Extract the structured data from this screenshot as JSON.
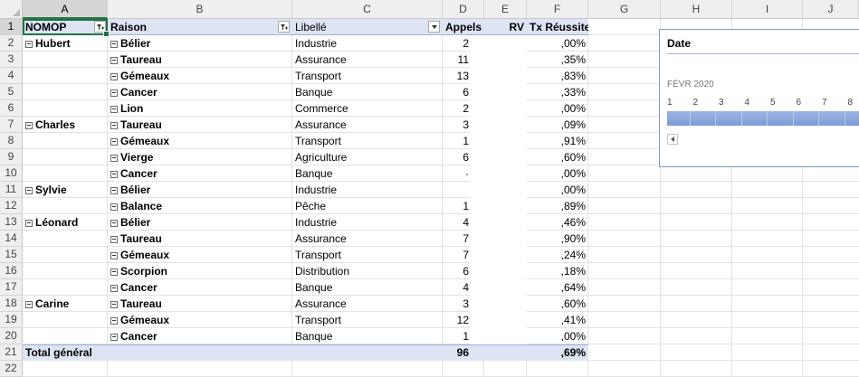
{
  "columns": [
    "A",
    "B",
    "C",
    "D",
    "E",
    "F",
    "G",
    "H",
    "I",
    "J"
  ],
  "rows": [
    "1",
    "2",
    "3",
    "4",
    "5",
    "6",
    "7",
    "8",
    "9",
    "10",
    "11",
    "12",
    "13",
    "14",
    "15",
    "16",
    "17",
    "18",
    "19",
    "20",
    "21",
    "22"
  ],
  "pivot_headers": {
    "nomop": "NOMOP",
    "raison": "Raison",
    "libelle": "Libellé",
    "appels": "Appels",
    "rv": "RV",
    "tx": "Tx Réussite"
  },
  "pivot_rows": [
    {
      "nomop": "Hubert",
      "raison": "Bélier",
      "libelle": "Industrie",
      "appels": "2",
      "tx": ",00%"
    },
    {
      "nomop": "",
      "raison": "Taureau",
      "libelle": "Assurance",
      "appels": "11",
      "tx": ",35%"
    },
    {
      "nomop": "",
      "raison": "Gémeaux",
      "libelle": "Transport",
      "appels": "13",
      "tx": ",83%"
    },
    {
      "nomop": "",
      "raison": "Cancer",
      "libelle": "Banque",
      "appels": "6",
      "tx": ",33%"
    },
    {
      "nomop": "",
      "raison": "Lion",
      "libelle": "Commerce",
      "appels": "2",
      "tx": ",00%"
    },
    {
      "nomop": "Charles",
      "raison": "Taureau",
      "libelle": "Assurance",
      "appels": "3",
      "tx": ",09%"
    },
    {
      "nomop": "",
      "raison": "Gémeaux",
      "libelle": "Transport",
      "appels": "1",
      "tx": ",91%"
    },
    {
      "nomop": "",
      "raison": "Vierge",
      "libelle": "Agriculture",
      "appels": "6",
      "tx": ",60%"
    },
    {
      "nomop": "",
      "raison": "Cancer",
      "libelle": "Banque",
      "appels": "·",
      "tx": ",00%"
    },
    {
      "nomop": "Sylvie",
      "raison": "Bélier",
      "libelle": "Industrie",
      "appels": "",
      "tx": ",00%"
    },
    {
      "nomop": "",
      "raison": "Balance",
      "libelle": "Pêche",
      "appels": "1",
      "tx": ",89%"
    },
    {
      "nomop": "Léonard",
      "raison": "Bélier",
      "libelle": "Industrie",
      "appels": "4",
      "tx": ",46%"
    },
    {
      "nomop": "",
      "raison": "Taureau",
      "libelle": "Assurance",
      "appels": "7",
      "tx": ",90%"
    },
    {
      "nomop": "",
      "raison": "Gémeaux",
      "libelle": "Transport",
      "appels": "7",
      "tx": ",24%"
    },
    {
      "nomop": "",
      "raison": "Scorpion",
      "libelle": "Distribution",
      "appels": "6",
      "tx": ",18%"
    },
    {
      "nomop": "",
      "raison": "Cancer",
      "libelle": "Banque",
      "appels": "4",
      "tx": ",64%"
    },
    {
      "nomop": "Carine",
      "raison": "Taureau",
      "libelle": "Assurance",
      "appels": "3",
      "tx": ",60%"
    },
    {
      "nomop": "",
      "raison": "Gémeaux",
      "libelle": "Transport",
      "appels": "12",
      "tx": ",41%"
    },
    {
      "nomop": "",
      "raison": "Cancer",
      "libelle": "Banque",
      "appels": "1",
      "tx": ",00%"
    }
  ],
  "total": {
    "label": "Total général",
    "appels": "96",
    "tx": ",69%"
  },
  "timeline": {
    "title": "Date",
    "period": "FÉVR 2020",
    "days": [
      "1",
      "2",
      "3",
      "4",
      "5",
      "6",
      "7",
      "8"
    ]
  },
  "colors": {
    "accent": "#217346",
    "pivot_header_bg": "#dde4f3",
    "timeline_bar": "#8aa6dc"
  }
}
